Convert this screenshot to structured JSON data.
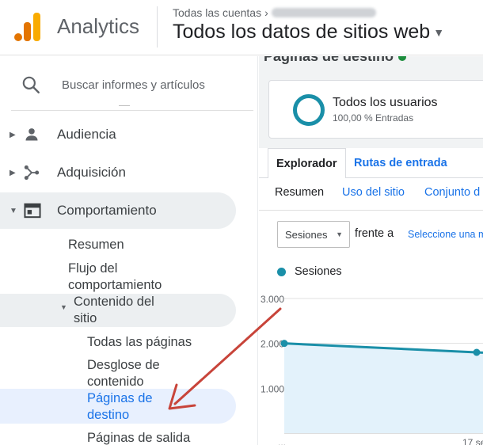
{
  "header": {
    "app_name": "Analytics",
    "breadcrumb_root": "Todas las cuentas",
    "view_title": "Todos los datos de sitios web"
  },
  "sidebar": {
    "search_placeholder": "Buscar informes y artículos",
    "items": [
      {
        "label": "Audiencia",
        "icon": "person-icon"
      },
      {
        "label": "Adquisición",
        "icon": "acquisition-icon"
      },
      {
        "label": "Comportamiento",
        "icon": "behavior-icon"
      }
    ],
    "behavior_sub": {
      "resumen": "Resumen",
      "flujo_line1": "Flujo del",
      "flujo_line2": "comportamiento",
      "contenido_line1": "Contenido del",
      "contenido_line2": "sitio",
      "todas": "Todas las páginas",
      "desglose_line1": "Desglose de",
      "desglose_line2": "contenido",
      "destino_line1": "Páginas de",
      "destino_line2": "destino",
      "salida": "Páginas de salida"
    }
  },
  "main": {
    "page_heading": "Páginas de destino",
    "segment": {
      "name": "Todos los usuarios",
      "detail": "100,00 % Entradas"
    },
    "tabs": [
      "Explorador",
      "Rutas de entrada"
    ],
    "subtabs": [
      "Resumen",
      "Uso del sitio",
      "Conjunto d"
    ],
    "metric_select": "Sesiones",
    "versus_label": "frente a",
    "select_metric_link": "Seleccione una m",
    "legend": "Sesiones"
  },
  "chart_data": {
    "type": "line",
    "series": [
      {
        "name": "Sesiones",
        "values": [
          2000,
          1800
        ]
      }
    ],
    "x": [
      "...",
      "17 se"
    ],
    "y_ticks": [
      "3.000",
      "2.000",
      "1.000"
    ],
    "ylim": [
      0,
      3000
    ],
    "grid": true,
    "colors": {
      "line": "#1a8fa8",
      "fill": "#e3f2fb"
    }
  }
}
